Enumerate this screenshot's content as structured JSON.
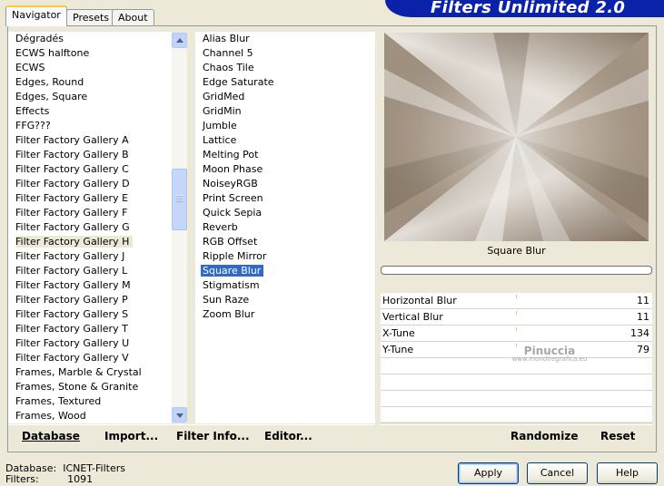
{
  "tabs": [
    {
      "label": "Navigator"
    },
    {
      "label": "Presets"
    },
    {
      "label": "About"
    }
  ],
  "app_title": "Filters Unlimited 2.0",
  "categories": {
    "items": [
      "Dégradés",
      "ECWS halftone",
      "ECWS",
      "Edges, Round",
      "Edges, Square",
      "Effects",
      "FFG???",
      "Filter Factory Gallery A",
      "Filter Factory Gallery B",
      "Filter Factory Gallery C",
      "Filter Factory Gallery D",
      "Filter Factory Gallery E",
      "Filter Factory Gallery F",
      "Filter Factory Gallery G",
      "Filter Factory Gallery H",
      "Filter Factory Gallery J",
      "Filter Factory Gallery L",
      "Filter Factory Gallery M",
      "Filter Factory Gallery P",
      "Filter Factory Gallery S",
      "Filter Factory Gallery T",
      "Filter Factory Gallery U",
      "Filter Factory Gallery V",
      "Frames, Marble & Crystal",
      "Frames, Stone & Granite",
      "Frames, Textured",
      "Frames, Wood"
    ],
    "selected": "Filter Factory Gallery H"
  },
  "filters": {
    "items": [
      "Alias Blur",
      "Channel 5",
      "Chaos Tile",
      "Edge Saturate",
      "GridMed",
      "GridMin",
      "Jumble",
      "Lattice",
      "Melting Pot",
      "Moon Phase",
      "NoiseyRGB",
      "Print Screen",
      "Quick Sepia",
      "Reverb",
      "RGB Offset",
      "Ripple Mirror",
      "Square Blur",
      "Stigmatism",
      "Sun Raze",
      "Zoom Blur"
    ],
    "selected": "Square Blur"
  },
  "preview": {
    "filter_name": "Square Blur",
    "colors": {
      "dark": "#7f6f5e",
      "light": "#ffffff"
    }
  },
  "parameters": [
    {
      "label": "Horizontal Blur",
      "value": "11"
    },
    {
      "label": "Vertical Blur",
      "value": "11"
    },
    {
      "label": "X-Tune",
      "value": "134"
    },
    {
      "label": "Y-Tune",
      "value": "79"
    }
  ],
  "watermark": {
    "name": "Pinuccia",
    "url": "www.mondiregrafica.eu"
  },
  "buttons": {
    "database": "Database",
    "import": "Import...",
    "filter_info": "Filter Info...",
    "editor": "Editor...",
    "randomize": "Randomize",
    "reset": "Reset",
    "apply": "Apply",
    "cancel": "Cancel",
    "help": "Help"
  },
  "status": {
    "database_label": "Database:",
    "database_value": "ICNET-Filters",
    "filters_label": "Filters:",
    "filters_value": "1091"
  },
  "colors": {
    "accent": "#0a22a8",
    "selection": "#316ac5"
  }
}
